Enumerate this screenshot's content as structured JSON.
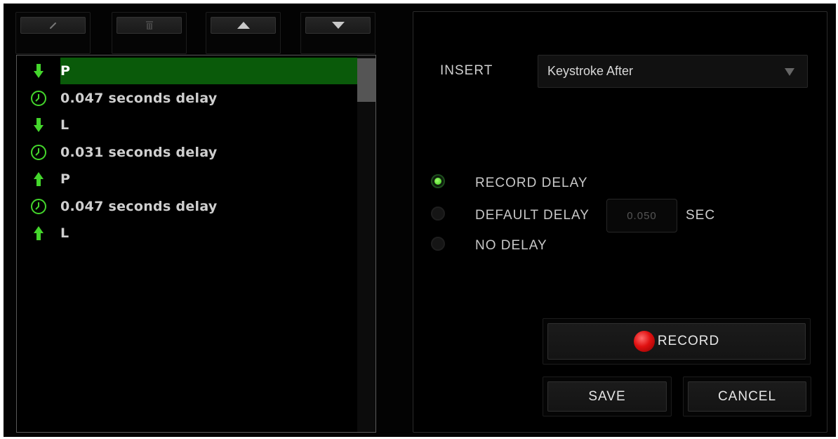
{
  "toolbar": {
    "buttons": [
      {
        "icon": "edit-icon"
      },
      {
        "icon": "trash-icon"
      },
      {
        "icon": "arrow-up-icon"
      },
      {
        "icon": "arrow-down-icon"
      }
    ]
  },
  "macro_list": {
    "items": [
      {
        "icon": "key-down-icon",
        "label": "P",
        "selected": true
      },
      {
        "icon": "clock-icon",
        "label": "0.047 seconds delay",
        "selected": false
      },
      {
        "icon": "key-down-icon",
        "label": "L",
        "selected": false
      },
      {
        "icon": "clock-icon",
        "label": "0.031 seconds delay",
        "selected": false
      },
      {
        "icon": "key-up-icon",
        "label": "P",
        "selected": false
      },
      {
        "icon": "clock-icon",
        "label": "0.047 seconds delay",
        "selected": false
      },
      {
        "icon": "key-up-icon",
        "label": "L",
        "selected": false
      }
    ]
  },
  "insert": {
    "label": "INSERT",
    "selected_value": "Keystroke After"
  },
  "delay_options": {
    "record_delay": "RECORD DELAY",
    "default_delay": "DEFAULT DELAY",
    "default_delay_value": "0.050",
    "unit": "SEC",
    "no_delay": "NO DELAY",
    "selected": "record_delay"
  },
  "actions": {
    "record_label": "RECORD",
    "save_label": "SAVE",
    "cancel_label": "CANCEL"
  },
  "colors": {
    "accent_green": "#44d62c",
    "selection_green": "#0a5a0a",
    "record_red": "#e01010"
  }
}
